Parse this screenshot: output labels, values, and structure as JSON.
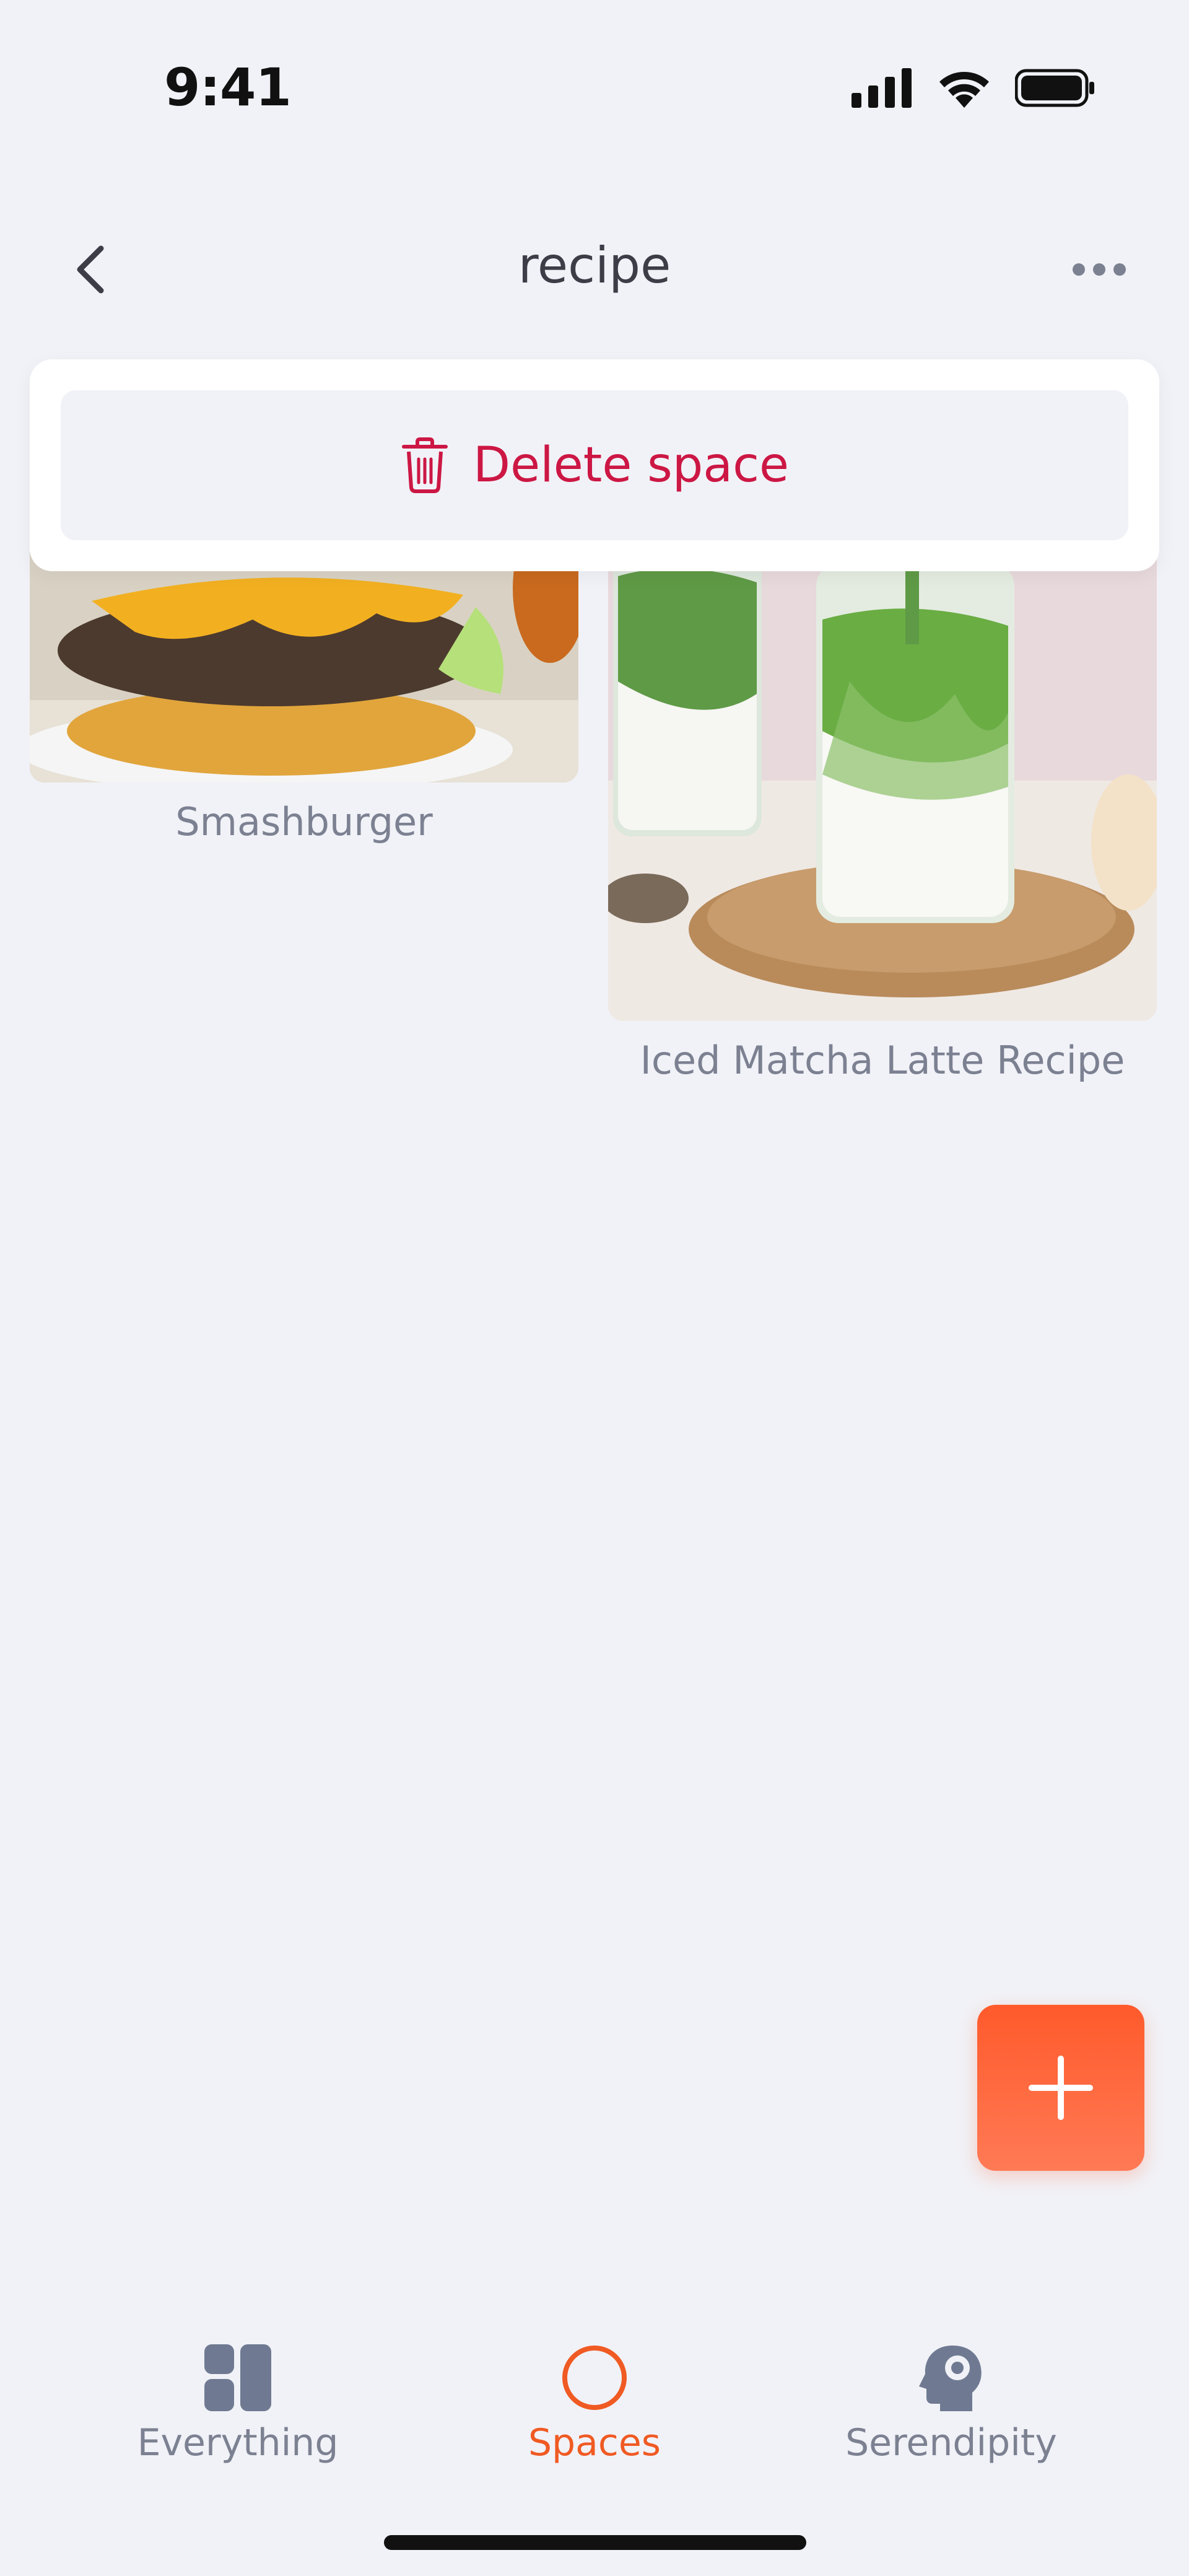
{
  "status_bar": {
    "time": "9:41"
  },
  "nav": {
    "title": "recipe",
    "back_icon": "chevron-left-icon",
    "more_icon": "ellipsis-icon"
  },
  "menu": {
    "delete_label": "Delete space",
    "delete_icon": "trash-icon",
    "delete_color": "#cc1744"
  },
  "items": [
    {
      "title": "Smashburger"
    },
    {
      "title": "Iced Matcha Latte Recipe"
    }
  ],
  "fab": {
    "icon": "plus-icon",
    "color": "#ff5a2b"
  },
  "tabs": [
    {
      "label": "Everything",
      "icon": "grid-icon",
      "active": false
    },
    {
      "label": "Spaces",
      "icon": "circle-icon",
      "active": true
    },
    {
      "label": "Serendipity",
      "icon": "head-icon",
      "active": false
    }
  ],
  "colors": {
    "accent": "#f05a23",
    "background": "#f1f2f7",
    "muted_text": "#7c8192"
  }
}
